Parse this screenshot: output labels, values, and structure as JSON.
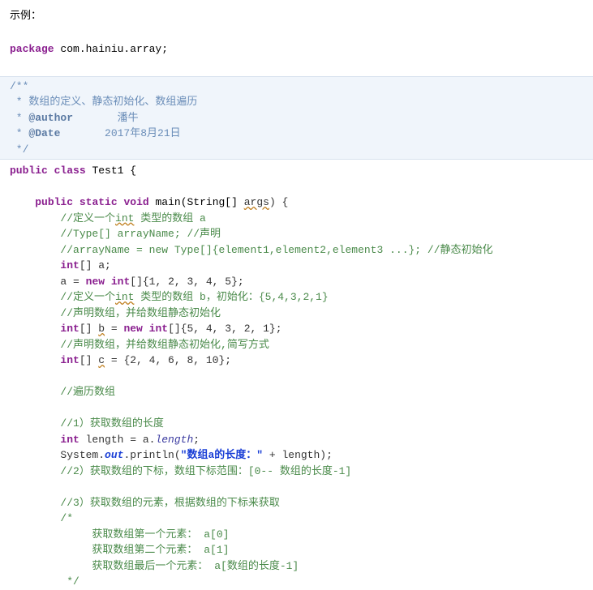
{
  "header": "示例：",
  "code": {
    "package_kw": "package",
    "package_name": " com.hainiu.array;",
    "doc_open": "/**",
    "doc_l1a": " * ",
    "doc_l1b": "数组的定义、静态初始化、数组遍历",
    "doc_l2a": " * ",
    "doc_l2_tag": "@author",
    "doc_l2b": "       潘牛",
    "doc_l3a": " * ",
    "doc_l3_tag": "@Date",
    "doc_l3b": "       2017年8月21日",
    "doc_close": " */",
    "public_kw": "public",
    "class_kw": "class",
    "class_name": " Test1 {",
    "static_kw": "static",
    "void_kw": "void",
    "main_name": " main(String[] ",
    "args": "args",
    "main_close": ") {",
    "c1a": "//定义一个",
    "c1b": "int",
    "c1c": " 类型的数组 a",
    "c2": "//Type[] arrayName; //声明",
    "c3": "//arrayName = new Type[]{element1,element2,element3 ...}; //静态初始化",
    "int_kw": "int",
    "a_decl": "[] a;",
    "a_assign1": "a = ",
    "new_kw": "new",
    "a_assign2": "[]{1, 2, 3, 4, 5};",
    "c4a": "//定义一个",
    "c4b": "int",
    "c4c": " 类型的数组 b，初始化：{5,4,3,2,1}",
    "c5": "//声明数组，并给数组静态初始化",
    "b_decl1": "[] ",
    "b_var": "b",
    "b_decl2": " = ",
    "b_decl3": "[]{5, 4, 3, 2, 1};",
    "c6": "//声明数组，并给数组静态初始化,简写方式",
    "c_decl1": "[] ",
    "c_var": "c",
    "c_decl2": " = {2, 4, 6, 8, 10};",
    "c7": "//遍历数组",
    "c8": "//1）获取数组的长度",
    "len_decl1": " length = a.",
    "len_field": "length",
    "len_decl2": ";",
    "sys": "System.",
    "out": "out",
    "println": ".println(",
    "str1": "\"数组a的长度：\"",
    "println2": " + length);",
    "c9": "//2）获取数组的下标，数组下标范围：[0-- 数组的长度-1]",
    "c10": "//3）获取数组的元素，根据数组的下标来获取",
    "bc_open": "/*",
    "bc_l1": "     获取数组第一个元素： a[0]",
    "bc_l2": "     获取数组第二个元素： a[1]",
    "bc_l3": "     获取数组最后一个元素： a[数组的长度-1]",
    "bc_close": " */"
  }
}
